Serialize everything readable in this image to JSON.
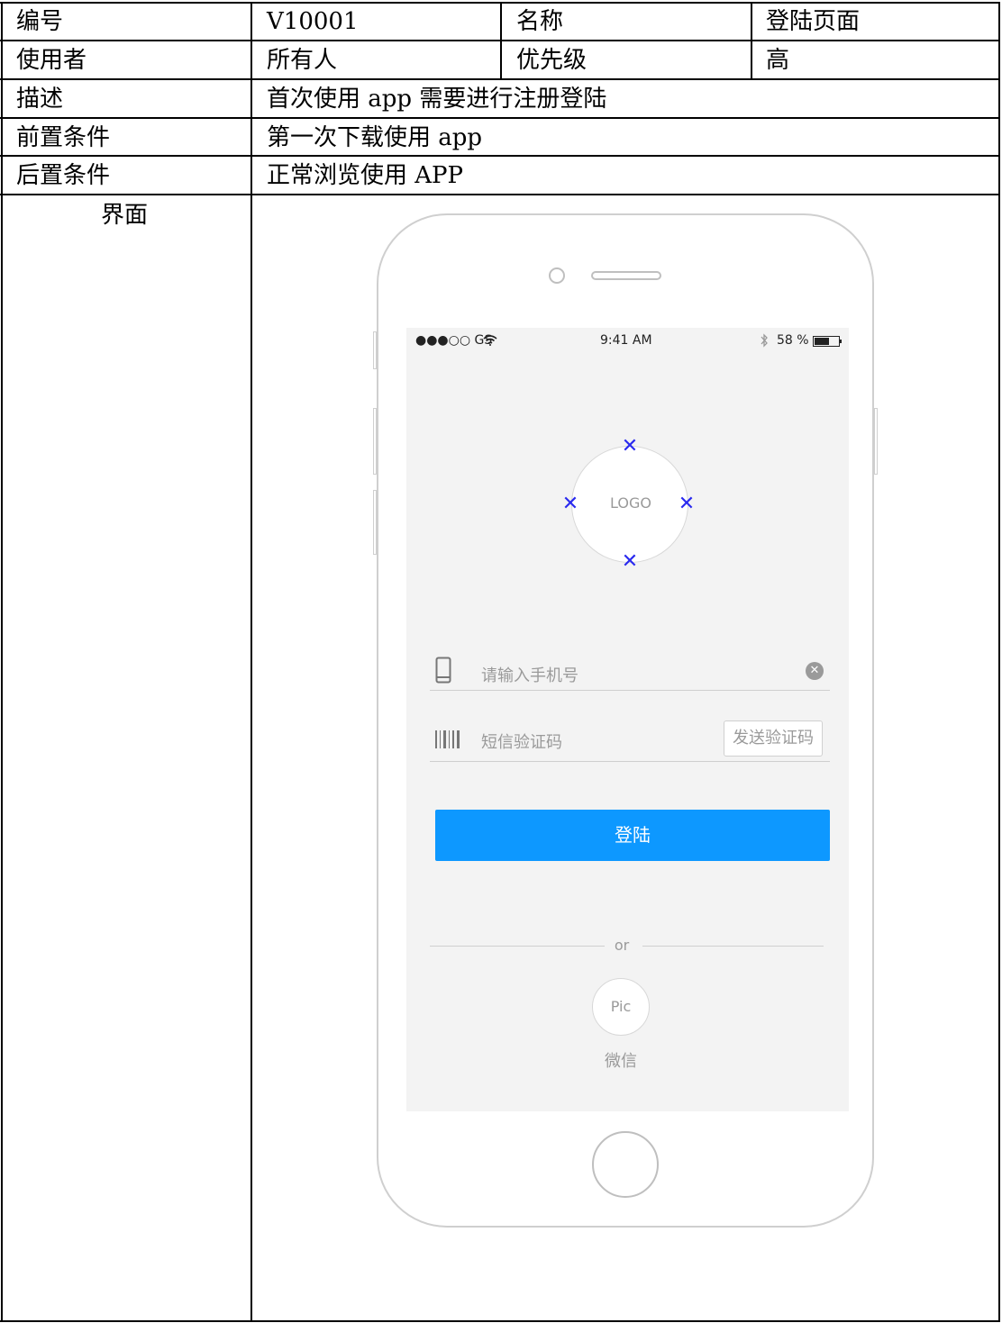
{
  "table": {
    "rows": [
      {
        "label": "编号",
        "value": "V10001",
        "label2": "名称",
        "value2": "登陆页面"
      },
      {
        "label": "使用者",
        "value": "所有人",
        "label2": "优先级",
        "value2": "高"
      },
      {
        "label": "描述",
        "value": "首次使用 app 需要进行注册登陆"
      },
      {
        "label": "前置条件",
        "value": "第一次下载使用 app"
      },
      {
        "label": "后置条件",
        "value": "正常浏览使用 APP"
      },
      {
        "label": "界面"
      }
    ]
  },
  "mockup": {
    "status_bar": {
      "carrier": "●●●○○ GS",
      "time": "9:41 AM",
      "battery": "58 %"
    },
    "logo_text": "LOGO",
    "phone_placeholder": "请输入手机号",
    "sms_placeholder": "短信验证码",
    "send_code_label": "发送验证码",
    "login_label": "登陆",
    "divider_text": "or",
    "pic_label": "Pic",
    "wechat_label": "微信",
    "colors": {
      "primary": "#0d98ff",
      "marker": "#2a2aef",
      "screen_bg": "#f3f3f3"
    }
  }
}
